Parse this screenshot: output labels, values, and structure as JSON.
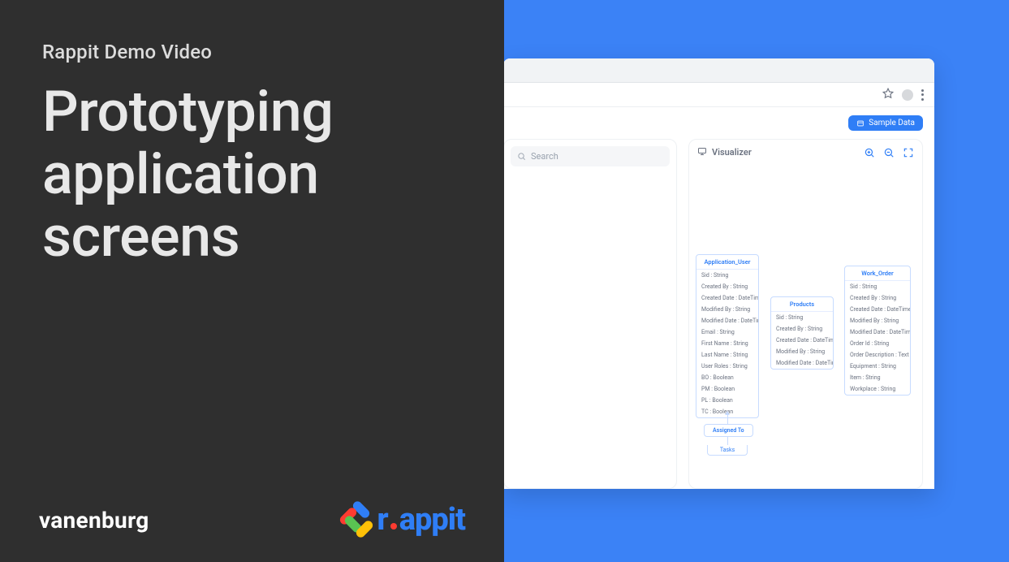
{
  "left_panel": {
    "eyebrow": "Rappit Demo Video",
    "headline": "Prototyping application screens",
    "brand_vanenburg": "vanenburg",
    "brand_rappit": "rappit"
  },
  "browser": {
    "star_icon": "star-icon",
    "menu_icon": "kebab-menu-icon"
  },
  "app": {
    "sample_data_button": "Sample Data",
    "search_placeholder": "Search",
    "visualizer_title": "Visualizer",
    "zoom_in_icon": "zoom-in-icon",
    "zoom_out_icon": "zoom-out-icon",
    "fullscreen_icon": "fullscreen-icon"
  },
  "entities": {
    "app_user": {
      "title": "Application_User",
      "fields": [
        "Sid : String",
        "Created By : String",
        "Created Date : DateTime",
        "Modified By : String",
        "Modified Date : DateTime",
        "Email : String",
        "First Name : String",
        "Last Name : String",
        "User Roles : String",
        "BO : Boolean",
        "PM : Boolean",
        "PL : Boolean",
        "TC : Boolean"
      ]
    },
    "products": {
      "title": "Products",
      "fields": [
        "Sid : String",
        "Created By : String",
        "Created Date : DateTime",
        "Modified By : String",
        "Modified Date : DateTime"
      ]
    },
    "work_order": {
      "title": "Work_Order",
      "fields": [
        "Sid : String",
        "Created By : String",
        "Created Date : DateTime",
        "Modified By : String",
        "Modified Date : DateTime",
        "Order Id : String",
        "Order Description : Text",
        "Equipment : String",
        "Item : String",
        "Workplace : String"
      ]
    },
    "relation_assigned_to": "Assigned To",
    "tasks_label": "Tasks"
  }
}
